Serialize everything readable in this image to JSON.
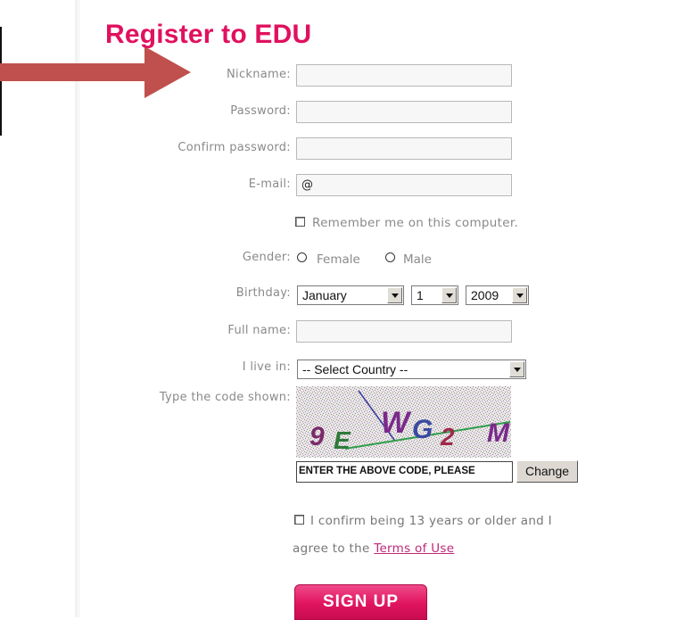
{
  "page": {
    "title": "Register to EDU"
  },
  "form": {
    "nickname": {
      "label": "Nickname:",
      "value": ""
    },
    "password": {
      "label": "Password:",
      "value": ""
    },
    "confirm_password": {
      "label": "Confirm password:",
      "value": ""
    },
    "email": {
      "label": "E-mail:",
      "value": "@"
    },
    "remember": {
      "label": "Remember me on this computer."
    },
    "gender": {
      "label": "Gender:",
      "female": "Female",
      "male": "Male"
    },
    "birthday": {
      "label": "Birthday:",
      "month": "January",
      "day": "1",
      "year": "2009"
    },
    "full_name": {
      "label": "Full name:",
      "value": ""
    },
    "country": {
      "label": "I live in:",
      "selected": "-- Select Country --"
    },
    "captcha": {
      "label": "Type the code shown:",
      "code_text": "9EWG2M",
      "input_value": "ENTER THE ABOVE CODE, PLEASE",
      "change_label": "Change"
    },
    "confirm": {
      "line1": "I confirm being 13 years or older and I",
      "prefix": "agree to the",
      "terms_link": "Terms of Use"
    },
    "signup_label": "SIGN UP"
  },
  "colors": {
    "accent": "#e0115f",
    "arrow": "#c0504d",
    "label": "#8a8a8a",
    "link": "#c0287a"
  }
}
